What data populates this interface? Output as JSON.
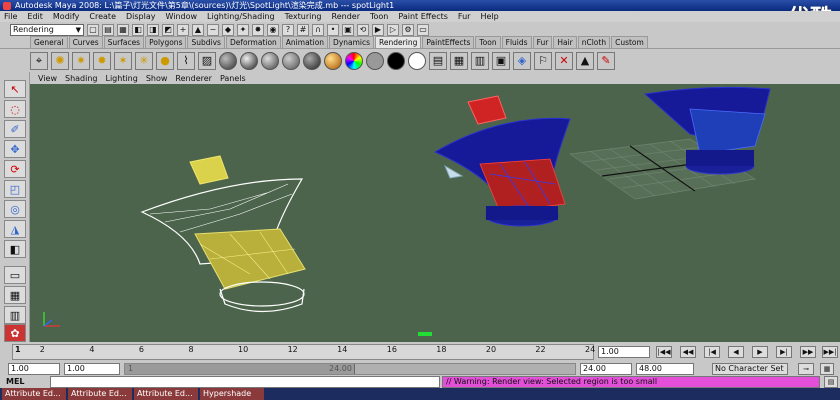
{
  "titlebar": {
    "title": "Autodesk Maya 2008: L:\\篇子\\灯光文件\\第5章\\(sources)\\灯光\\SpotLight\\渲染完成.mb  ---  spotLight1"
  },
  "watermark": "优酷",
  "menu": [
    "File",
    "Edit",
    "Modify",
    "Create",
    "Display",
    "Window",
    "Lighting/Shading",
    "Texturing",
    "Render",
    "Toon",
    "Paint Effects",
    "Fur",
    "Help"
  ],
  "statusline": {
    "mode": "Rendering"
  },
  "shelf_tabs": [
    "General",
    "Curves",
    "Surfaces",
    "Polygons",
    "Subdivs",
    "Deformation",
    "Animation",
    "Dynamics",
    "Rendering",
    "PaintEffects",
    "Toon",
    "Fluids",
    "Fur",
    "Hair",
    "nCloth",
    "Custom"
  ],
  "active_shelf_tab": "Rendering",
  "panel_menu": [
    "View",
    "Shading",
    "Lighting",
    "Show",
    "Renderer",
    "Panels"
  ],
  "timeline": {
    "ticks": [
      "1",
      "2",
      "4",
      "6",
      "8",
      "10",
      "12",
      "14",
      "16",
      "18",
      "20",
      "22",
      "24"
    ],
    "current_frame": "1.00"
  },
  "range": {
    "start": "1.00",
    "playback_start": "1.00",
    "handle_start": "1",
    "handle_end": "24.00",
    "playback_end": "24.00",
    "end": "48.00",
    "character_set": "No Character Set"
  },
  "command": {
    "label": "MEL",
    "result": "// Warning: Render view: Selected region is too small"
  },
  "taskbar": [
    "Attribute Ed...",
    "Attribute Ed...",
    "Attribute Ed...",
    "Hypershade"
  ],
  "colors": {
    "viewport": "#4b644b",
    "warning": "#e34fd8"
  }
}
